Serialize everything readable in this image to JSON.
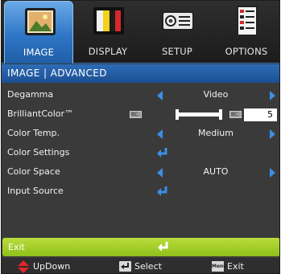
{
  "tabs": [
    {
      "label": "IMAGE",
      "icon": "image-icon",
      "active": true
    },
    {
      "label": "DISPLAY",
      "icon": "display-icon",
      "active": false
    },
    {
      "label": "SETUP",
      "icon": "projector-icon",
      "active": false
    },
    {
      "label": "OPTIONS",
      "icon": "options-icon",
      "active": false
    }
  ],
  "breadcrumb": "IMAGE | ADVANCED",
  "rows": {
    "degamma": {
      "label": "Degamma",
      "value": "Video"
    },
    "brilliant_color": {
      "label": "BrilliantColor™",
      "value": "5",
      "min_label": "BC",
      "max_label": "BC",
      "level": 0.5
    },
    "color_temp": {
      "label": "Color Temp.",
      "value": "Medium"
    },
    "color_settings": {
      "label": "Color Settings"
    },
    "color_space": {
      "label": "Color Space",
      "value": "AUTO"
    },
    "input_source": {
      "label": "Input Source"
    }
  },
  "exit": {
    "label": "Exit"
  },
  "footer": {
    "updown": "UpDown",
    "select": "Select",
    "menu_key": "Menu",
    "exit": "Exit"
  },
  "colors": {
    "accent_blue": "#2f76c6",
    "arrow_blue": "#3b8fe6",
    "exit_green": "#9fcb26",
    "background": "#3a3a3a"
  }
}
